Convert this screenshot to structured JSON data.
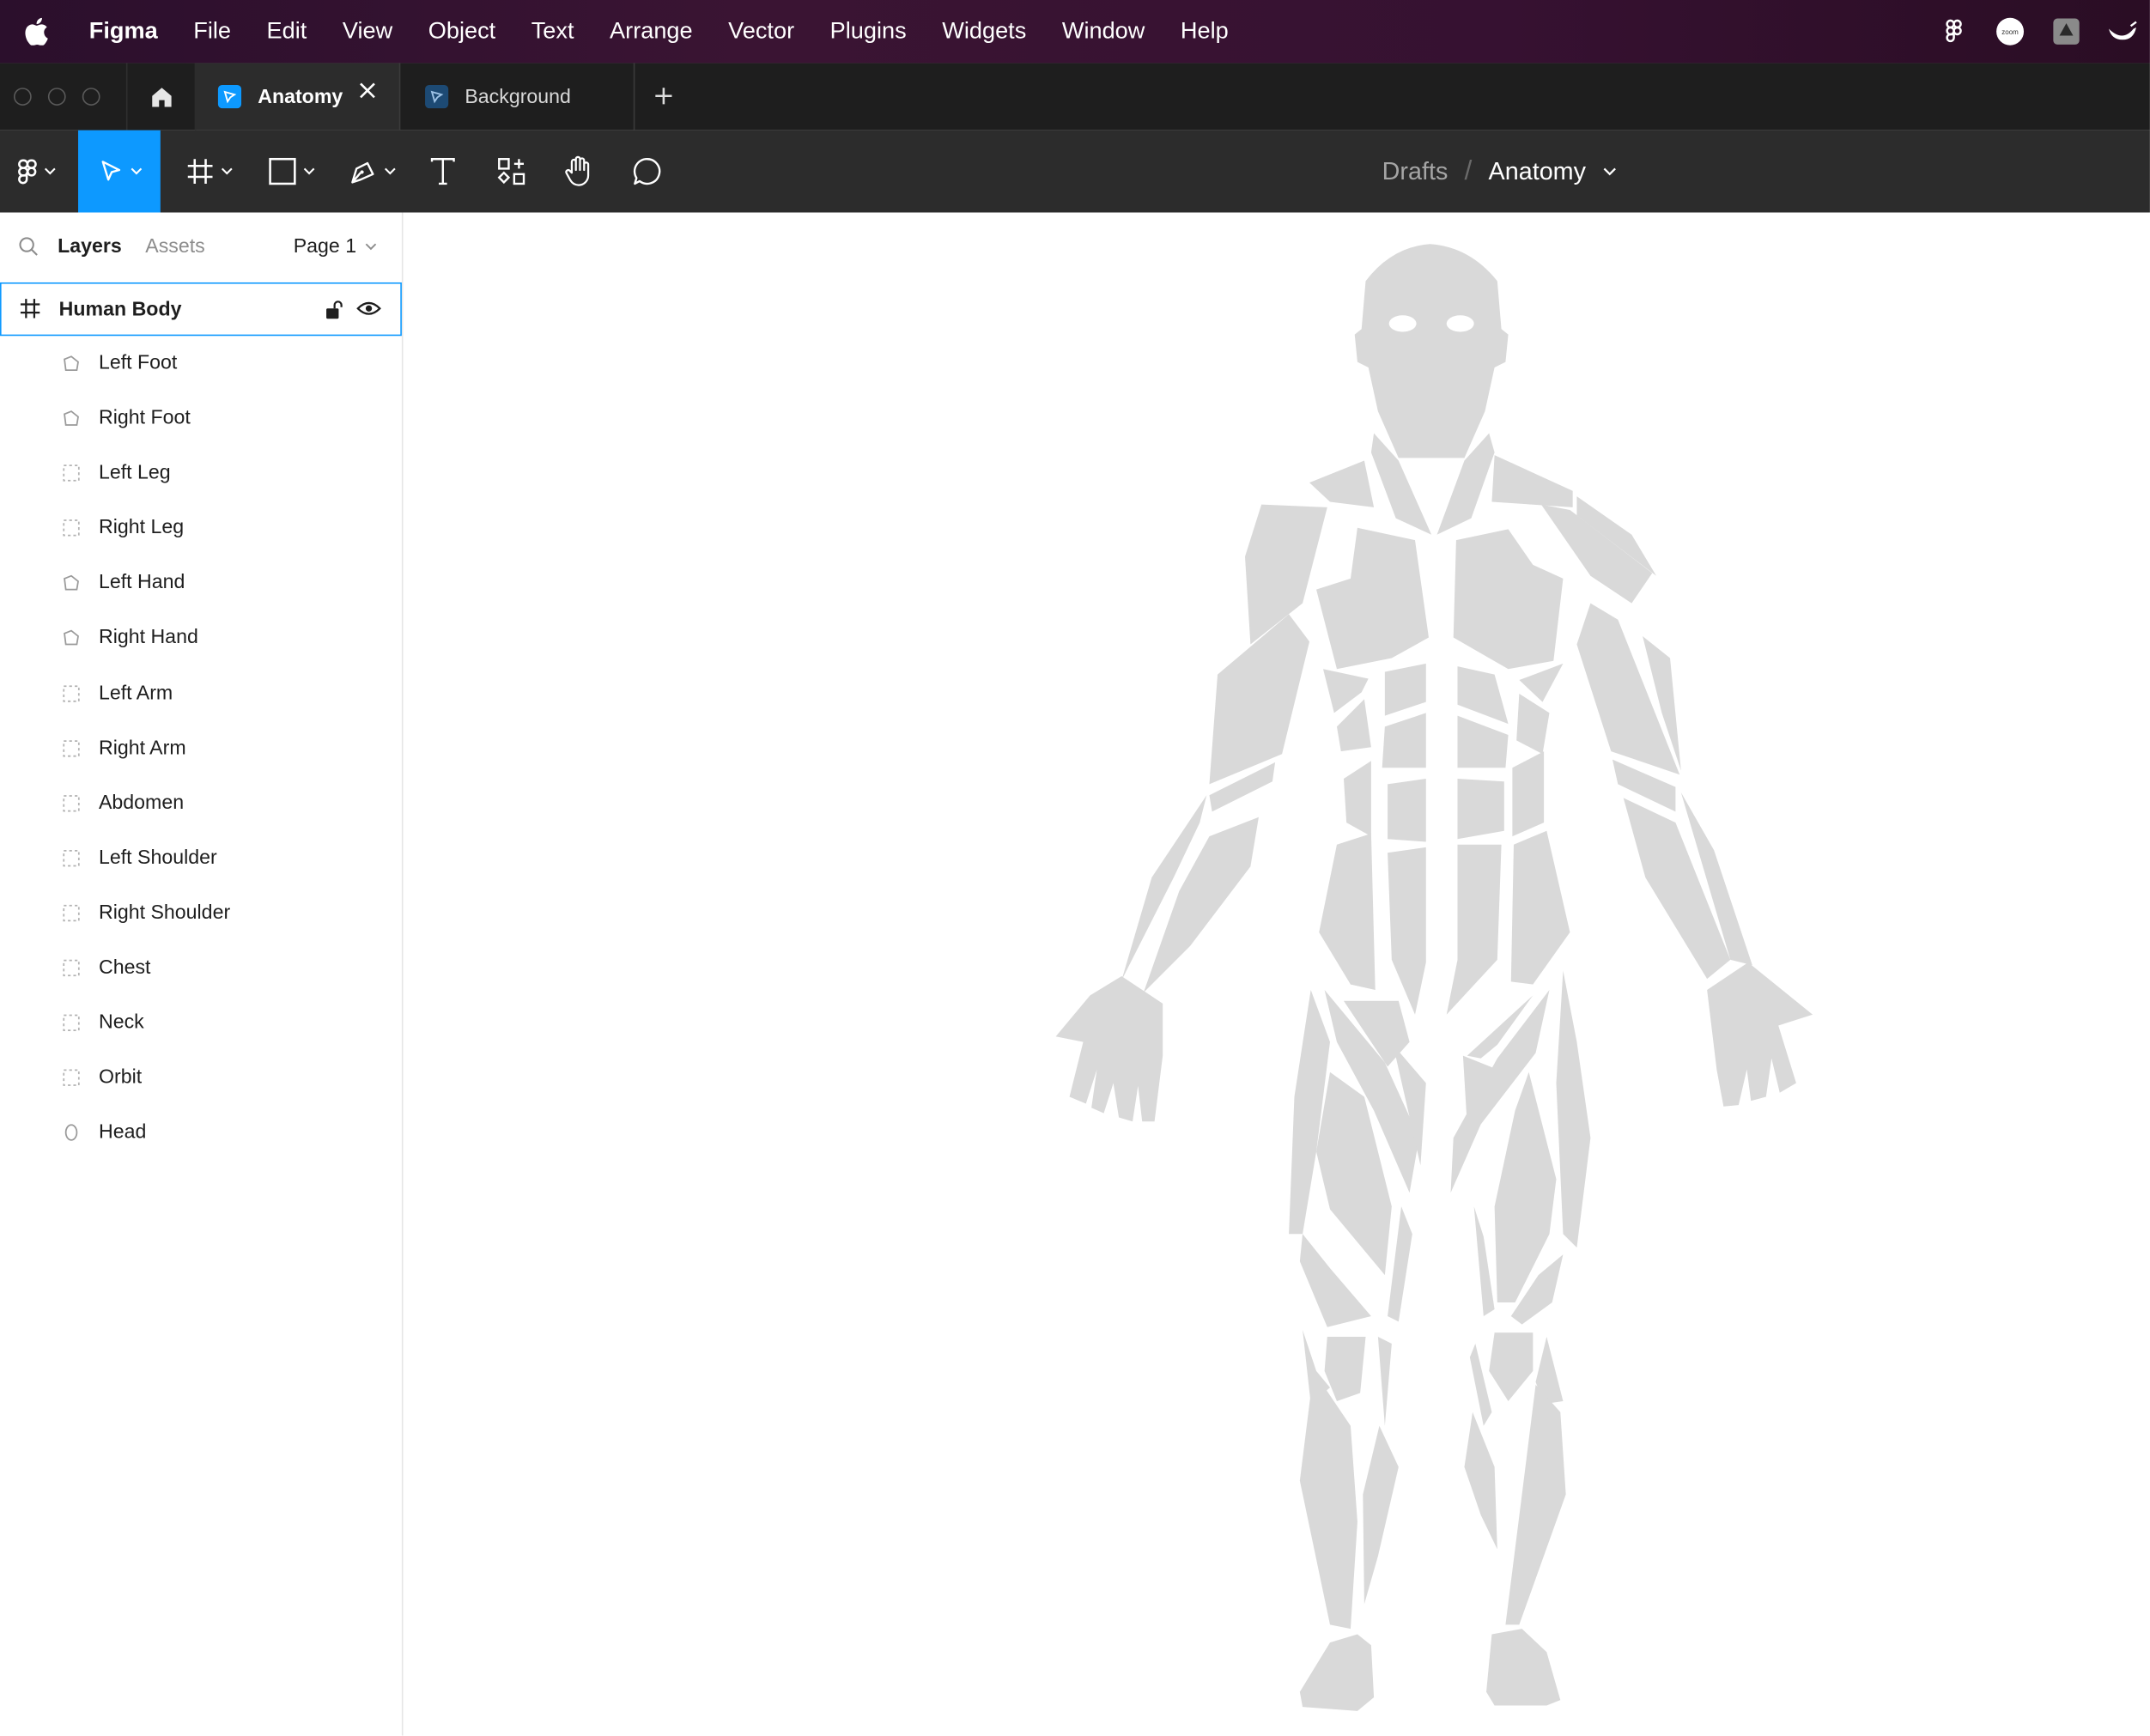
{
  "menubar": {
    "app_name": "Figma",
    "items": [
      "File",
      "Edit",
      "View",
      "Object",
      "Text",
      "Arrange",
      "Vector",
      "Plugins",
      "Widgets",
      "Window",
      "Help"
    ],
    "status_icons": [
      "figma-icon",
      "zoom-icon",
      "drive-icon",
      "cup-icon"
    ],
    "zoom_text": "zoom"
  },
  "tabs": {
    "items": [
      {
        "label": "Anatomy",
        "active": true
      },
      {
        "label": "Background",
        "active": false
      }
    ]
  },
  "toolbar": {
    "tools": [
      "main-menu",
      "move",
      "frame",
      "shape",
      "pen",
      "text",
      "resources",
      "hand",
      "comment"
    ],
    "active_tool": "move"
  },
  "breadcrumb": {
    "location": "Drafts",
    "separator": "/",
    "file": "Anatomy"
  },
  "left_panel": {
    "tab_layers": "Layers",
    "tab_assets": "Assets",
    "page": "Page 1",
    "frame": {
      "label": "Human Body"
    },
    "layers": [
      {
        "label": "Left Foot",
        "icon": "vector-icon"
      },
      {
        "label": "Right Foot",
        "icon": "vector-icon"
      },
      {
        "label": "Left Leg",
        "icon": "group-icon"
      },
      {
        "label": "Right Leg",
        "icon": "group-icon"
      },
      {
        "label": "Left Hand",
        "icon": "vector-icon"
      },
      {
        "label": "Right Hand",
        "icon": "vector-icon"
      },
      {
        "label": "Left Arm",
        "icon": "group-icon"
      },
      {
        "label": "Right Arm",
        "icon": "group-icon"
      },
      {
        "label": "Abdomen",
        "icon": "group-icon"
      },
      {
        "label": "Left Shoulder",
        "icon": "group-icon"
      },
      {
        "label": "Right Shoulder",
        "icon": "group-icon"
      },
      {
        "label": "Chest",
        "icon": "group-icon"
      },
      {
        "label": "Neck",
        "icon": "group-icon"
      },
      {
        "label": "Orbit",
        "icon": "group-icon"
      },
      {
        "label": "Head",
        "icon": "ellipse-icon"
      }
    ]
  },
  "colors": {
    "accent": "#0d99ff",
    "toolbar_bg": "#2c2c2c",
    "tabbar_bg": "#1e1e1e",
    "body_fill": "#d9d9d9"
  }
}
